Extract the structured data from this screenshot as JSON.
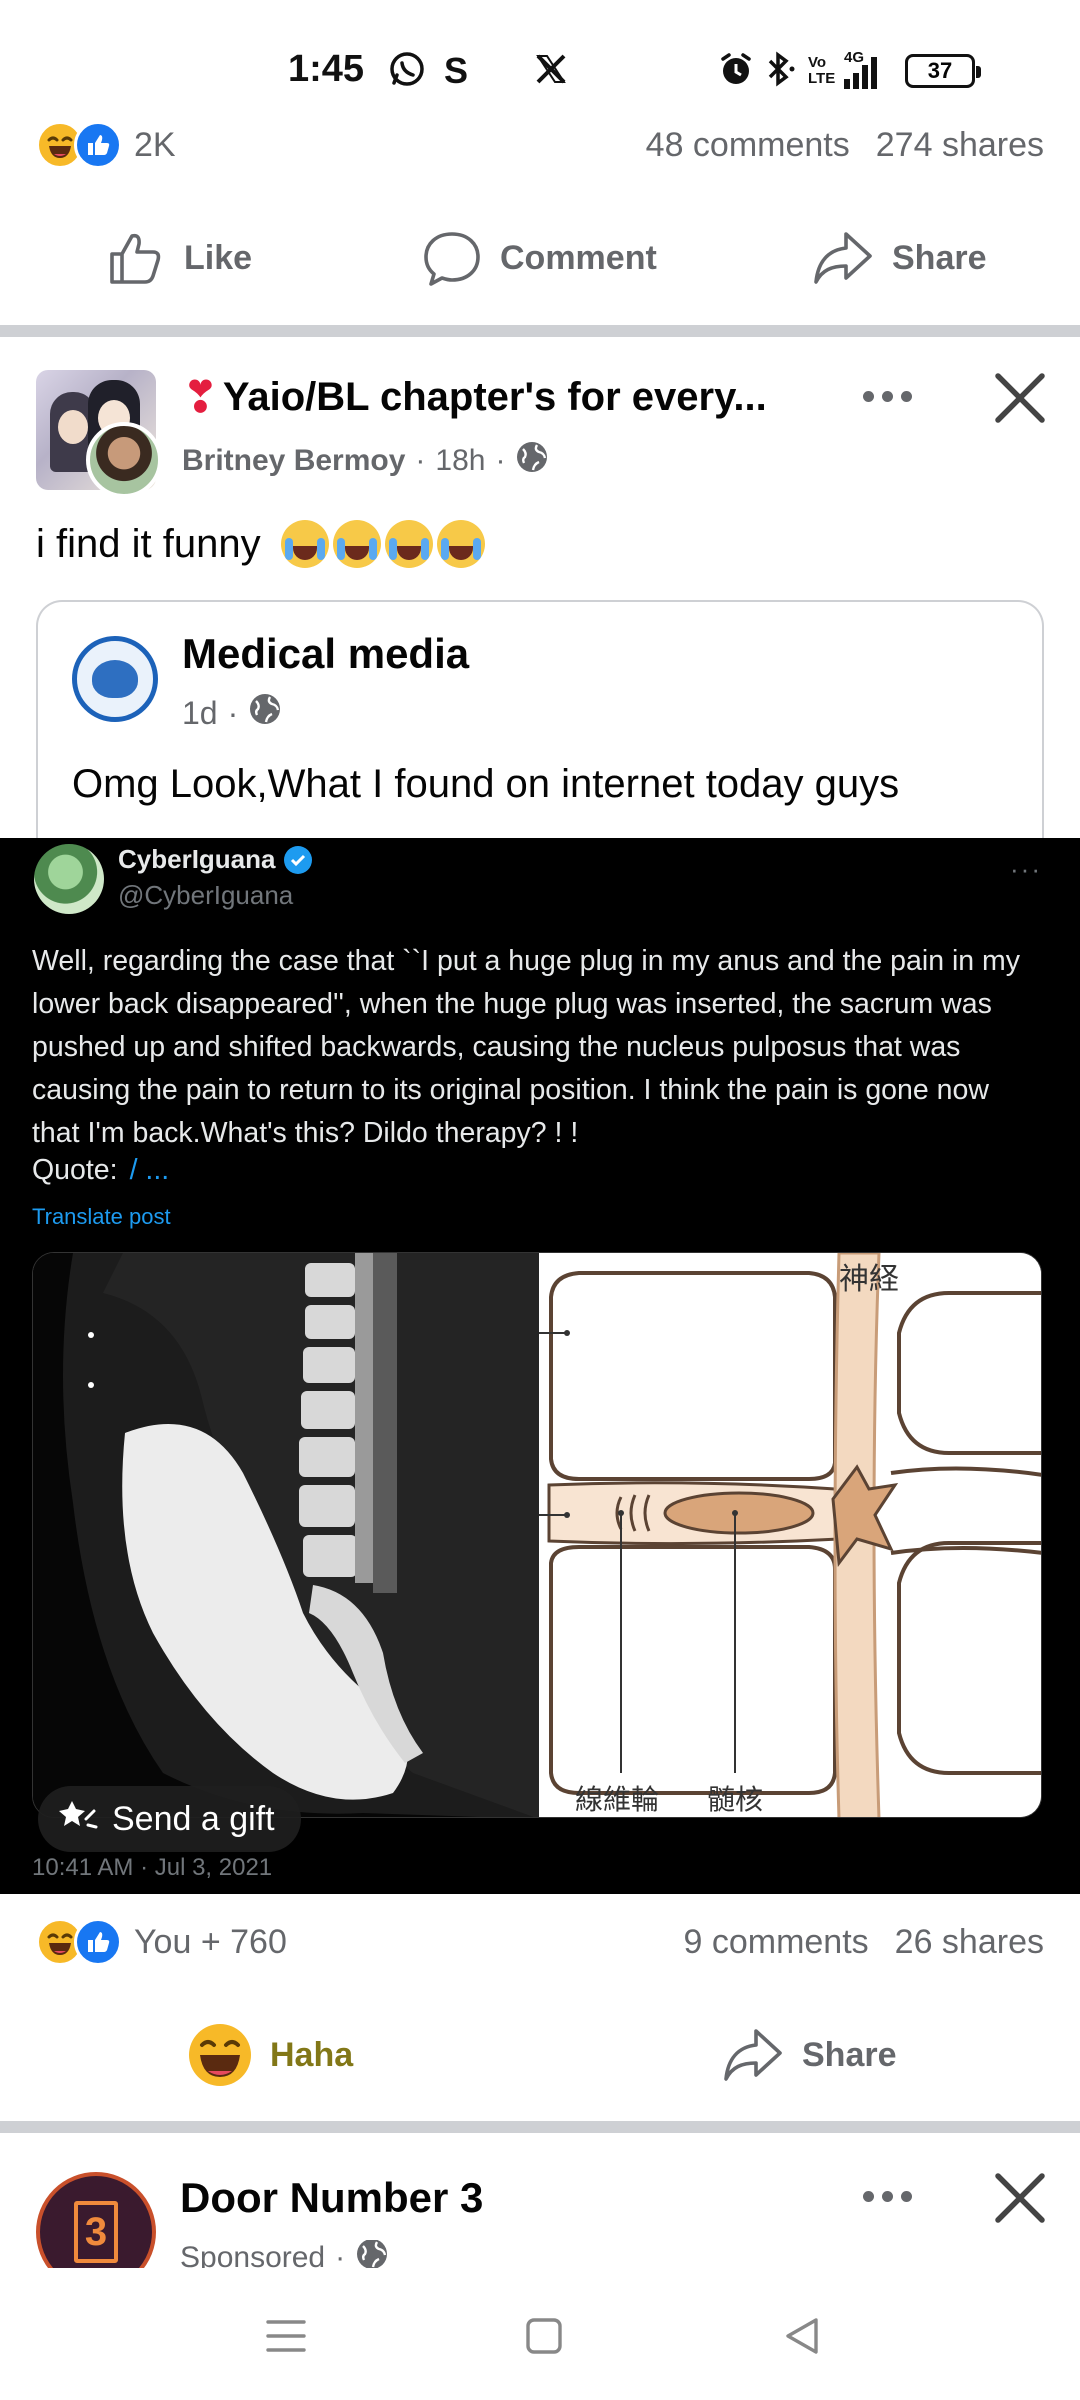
{
  "status_bar": {
    "time": "1:45",
    "left_icons": [
      "whatsapp-icon",
      "s-app-icon",
      "x-icon"
    ],
    "right_icons": [
      "alarm-icon",
      "bluetooth-icon",
      "volte-icon",
      "4g-signal-icon"
    ],
    "volte_label": "Vo LTE",
    "network_label": "4G",
    "battery": "37"
  },
  "prev_post": {
    "reaction_count": "2K",
    "comments": "48 comments",
    "shares": "274 shares",
    "actions": {
      "like": "Like",
      "comment": "Comment",
      "share": "Share"
    }
  },
  "post": {
    "group_name": "Yaio/BL chapter's for every...",
    "author": "Britney Bermoy",
    "time": "18h",
    "separator": "·",
    "text": "i find it funny",
    "shared": {
      "page_name": "Medical media",
      "time": "1d",
      "text": "Omg Look,What I found on internet today guys"
    },
    "embedded_tweet": {
      "name": "CyberIguana",
      "handle": "@CyberIguana",
      "more": "···",
      "body": "Well, regarding the case that ``I put a huge plug in my anus and the pain in my lower back disappeared'', when the huge plug was inserted, the sacrum was pushed up and shifted backwards, causing the nucleus pulposus that was causing the pain to return to its original position. I think the pain is gone now that I'm back.What's this? Dildo therapy? ! !",
      "quote_label": "Quote:",
      "quote_link": "/ ...",
      "translate": "Translate post",
      "diagram_labels": {
        "nerve": "神経",
        "annulus": "線維輪",
        "nucleus": "髄核"
      },
      "gift_label": "Send a gift",
      "timestamp": "10:41 AM · Jul 3, 2021"
    },
    "reactions": "You + 760",
    "comments": "9 comments",
    "shares": "26 shares",
    "actions": {
      "haha": "Haha",
      "share": "Share"
    },
    "haha_color": "#827717"
  },
  "ad_post": {
    "name": "Door Number 3",
    "door_number": "3",
    "meta": "Sponsored",
    "separator": "·"
  },
  "nav_bar": {
    "icons": [
      "menu-icon",
      "home-square-icon",
      "back-triangle-icon"
    ]
  },
  "colors": {
    "facebook_blue": "#1877f2",
    "haha_yellow": "#f7b928",
    "secondary_text": "#65676b",
    "divider": "#ced0d4",
    "twitter_blue": "#1d9bf0"
  }
}
